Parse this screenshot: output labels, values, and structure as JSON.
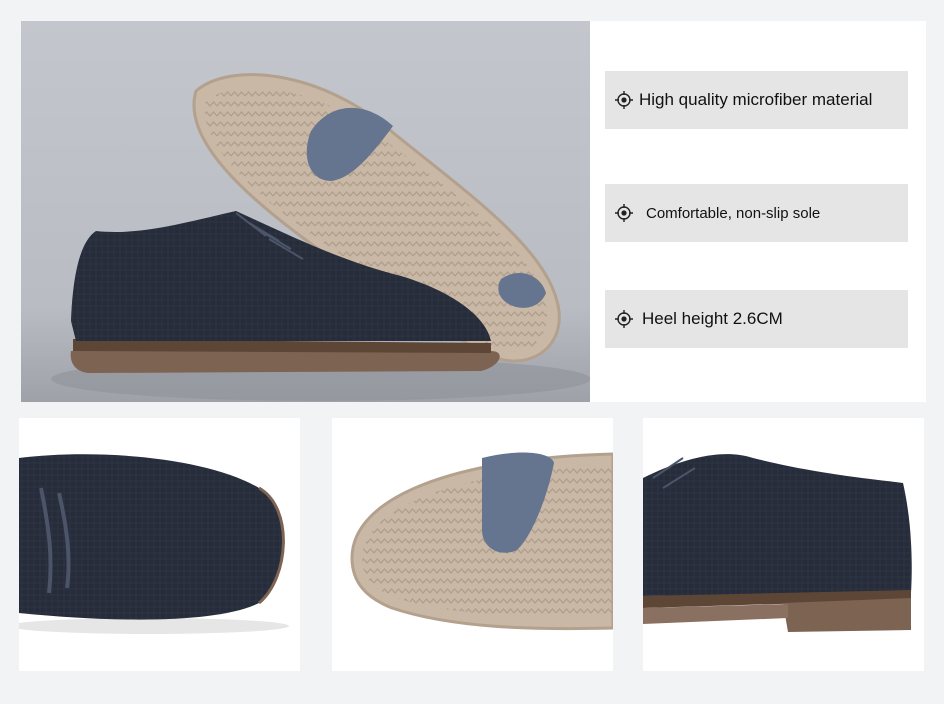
{
  "features": [
    {
      "icon": "crosshair-target-icon",
      "label": "High quality microfiber material"
    },
    {
      "icon": "crosshair-target-icon",
      "label": "Comfortable, non-slip sole"
    },
    {
      "icon": "crosshair-target-icon",
      "label": "Heel height 2.6CM"
    }
  ],
  "colors": {
    "page_background": "#f2f3f5",
    "chip_background": "#e5e5e5",
    "shoe_upper": "#262c3a",
    "sole": "#c9b8a6",
    "heel_pad": "#65758f"
  }
}
